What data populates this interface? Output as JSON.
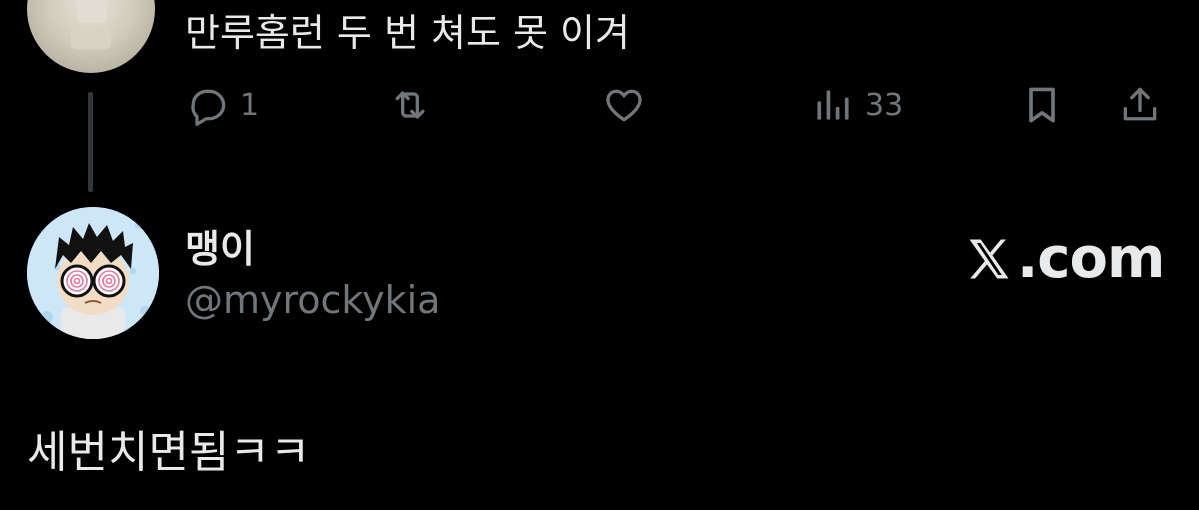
{
  "reply": {
    "text": "만루홈런 두 번 쳐도 못 이겨",
    "actions": {
      "reply_count": "1",
      "repost_count": "",
      "like_count": "",
      "views_count": "33"
    },
    "icons": [
      "speech-bubble-icon",
      "repost-icon",
      "heart-icon",
      "bar-chart-icon",
      "bookmark-icon",
      "share-icon"
    ]
  },
  "tweet": {
    "display_name": "맹이",
    "handle": "@myrockykia",
    "text": "세번치면됨ㅋㅋ"
  },
  "brand": {
    "label": ".com",
    "icon": "x-logo-icon"
  },
  "colors": {
    "background": "#000000",
    "primary_text": "#e7e9ea",
    "secondary_text": "#71767b",
    "thread_line": "#333639"
  }
}
